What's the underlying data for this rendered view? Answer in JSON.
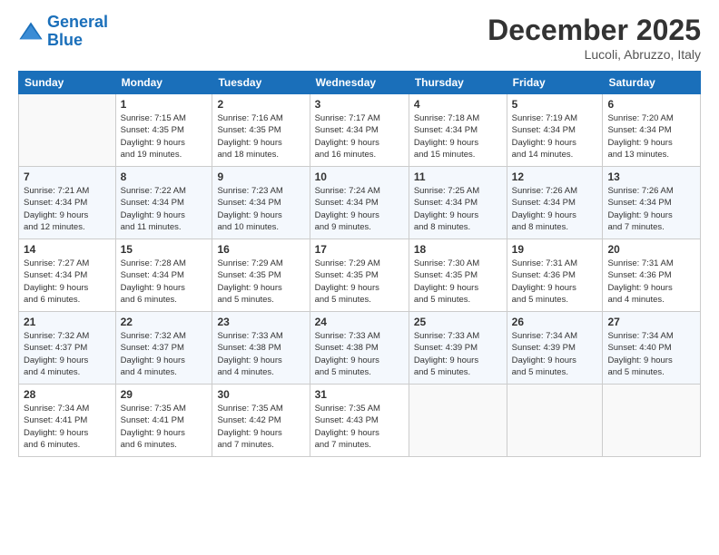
{
  "header": {
    "logo_general": "General",
    "logo_blue": "Blue",
    "month": "December 2025",
    "location": "Lucoli, Abruzzo, Italy"
  },
  "weekdays": [
    "Sunday",
    "Monday",
    "Tuesday",
    "Wednesday",
    "Thursday",
    "Friday",
    "Saturday"
  ],
  "weeks": [
    [
      {
        "day": "",
        "info": ""
      },
      {
        "day": "1",
        "info": "Sunrise: 7:15 AM\nSunset: 4:35 PM\nDaylight: 9 hours\nand 19 minutes."
      },
      {
        "day": "2",
        "info": "Sunrise: 7:16 AM\nSunset: 4:35 PM\nDaylight: 9 hours\nand 18 minutes."
      },
      {
        "day": "3",
        "info": "Sunrise: 7:17 AM\nSunset: 4:34 PM\nDaylight: 9 hours\nand 16 minutes."
      },
      {
        "day": "4",
        "info": "Sunrise: 7:18 AM\nSunset: 4:34 PM\nDaylight: 9 hours\nand 15 minutes."
      },
      {
        "day": "5",
        "info": "Sunrise: 7:19 AM\nSunset: 4:34 PM\nDaylight: 9 hours\nand 14 minutes."
      },
      {
        "day": "6",
        "info": "Sunrise: 7:20 AM\nSunset: 4:34 PM\nDaylight: 9 hours\nand 13 minutes."
      }
    ],
    [
      {
        "day": "7",
        "info": "Sunrise: 7:21 AM\nSunset: 4:34 PM\nDaylight: 9 hours\nand 12 minutes."
      },
      {
        "day": "8",
        "info": "Sunrise: 7:22 AM\nSunset: 4:34 PM\nDaylight: 9 hours\nand 11 minutes."
      },
      {
        "day": "9",
        "info": "Sunrise: 7:23 AM\nSunset: 4:34 PM\nDaylight: 9 hours\nand 10 minutes."
      },
      {
        "day": "10",
        "info": "Sunrise: 7:24 AM\nSunset: 4:34 PM\nDaylight: 9 hours\nand 9 minutes."
      },
      {
        "day": "11",
        "info": "Sunrise: 7:25 AM\nSunset: 4:34 PM\nDaylight: 9 hours\nand 8 minutes."
      },
      {
        "day": "12",
        "info": "Sunrise: 7:26 AM\nSunset: 4:34 PM\nDaylight: 9 hours\nand 8 minutes."
      },
      {
        "day": "13",
        "info": "Sunrise: 7:26 AM\nSunset: 4:34 PM\nDaylight: 9 hours\nand 7 minutes."
      }
    ],
    [
      {
        "day": "14",
        "info": "Sunrise: 7:27 AM\nSunset: 4:34 PM\nDaylight: 9 hours\nand 6 minutes."
      },
      {
        "day": "15",
        "info": "Sunrise: 7:28 AM\nSunset: 4:34 PM\nDaylight: 9 hours\nand 6 minutes."
      },
      {
        "day": "16",
        "info": "Sunrise: 7:29 AM\nSunset: 4:35 PM\nDaylight: 9 hours\nand 5 minutes."
      },
      {
        "day": "17",
        "info": "Sunrise: 7:29 AM\nSunset: 4:35 PM\nDaylight: 9 hours\nand 5 minutes."
      },
      {
        "day": "18",
        "info": "Sunrise: 7:30 AM\nSunset: 4:35 PM\nDaylight: 9 hours\nand 5 minutes."
      },
      {
        "day": "19",
        "info": "Sunrise: 7:31 AM\nSunset: 4:36 PM\nDaylight: 9 hours\nand 5 minutes."
      },
      {
        "day": "20",
        "info": "Sunrise: 7:31 AM\nSunset: 4:36 PM\nDaylight: 9 hours\nand 4 minutes."
      }
    ],
    [
      {
        "day": "21",
        "info": "Sunrise: 7:32 AM\nSunset: 4:37 PM\nDaylight: 9 hours\nand 4 minutes."
      },
      {
        "day": "22",
        "info": "Sunrise: 7:32 AM\nSunset: 4:37 PM\nDaylight: 9 hours\nand 4 minutes."
      },
      {
        "day": "23",
        "info": "Sunrise: 7:33 AM\nSunset: 4:38 PM\nDaylight: 9 hours\nand 4 minutes."
      },
      {
        "day": "24",
        "info": "Sunrise: 7:33 AM\nSunset: 4:38 PM\nDaylight: 9 hours\nand 5 minutes."
      },
      {
        "day": "25",
        "info": "Sunrise: 7:33 AM\nSunset: 4:39 PM\nDaylight: 9 hours\nand 5 minutes."
      },
      {
        "day": "26",
        "info": "Sunrise: 7:34 AM\nSunset: 4:39 PM\nDaylight: 9 hours\nand 5 minutes."
      },
      {
        "day": "27",
        "info": "Sunrise: 7:34 AM\nSunset: 4:40 PM\nDaylight: 9 hours\nand 5 minutes."
      }
    ],
    [
      {
        "day": "28",
        "info": "Sunrise: 7:34 AM\nSunset: 4:41 PM\nDaylight: 9 hours\nand 6 minutes."
      },
      {
        "day": "29",
        "info": "Sunrise: 7:35 AM\nSunset: 4:41 PM\nDaylight: 9 hours\nand 6 minutes."
      },
      {
        "day": "30",
        "info": "Sunrise: 7:35 AM\nSunset: 4:42 PM\nDaylight: 9 hours\nand 7 minutes."
      },
      {
        "day": "31",
        "info": "Sunrise: 7:35 AM\nSunset: 4:43 PM\nDaylight: 9 hours\nand 7 minutes."
      },
      {
        "day": "",
        "info": ""
      },
      {
        "day": "",
        "info": ""
      },
      {
        "day": "",
        "info": ""
      }
    ]
  ]
}
